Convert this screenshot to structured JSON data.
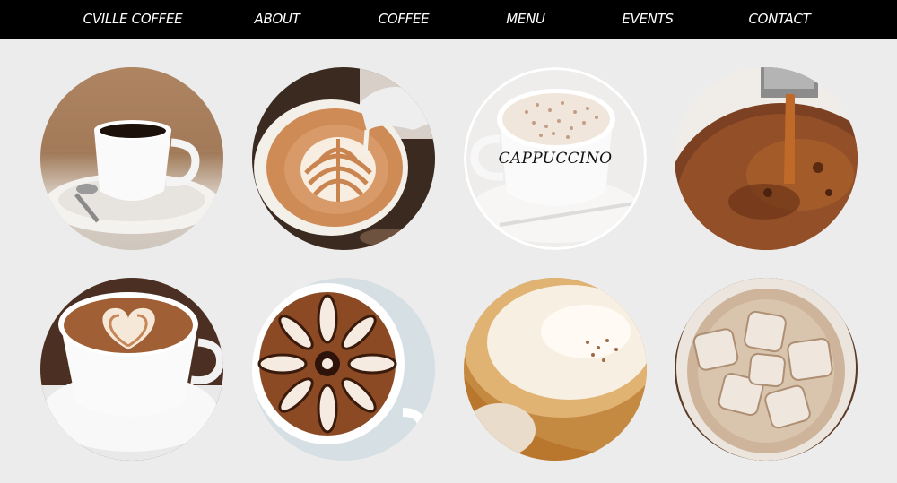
{
  "nav": {
    "items": [
      "CVILLE COFFEE",
      "ABOUT",
      "COFFEE",
      "MENU",
      "EVENTS",
      "CONTACT"
    ]
  },
  "gallery": {
    "tiles": [
      {
        "subject": "black coffee cup on saucer with spoon",
        "label": ""
      },
      {
        "subject": "latte art being poured from milk pitcher",
        "label": ""
      },
      {
        "subject": "cappuccino cup with chocolate sprinkles",
        "label": "CAPPUCCINO"
      },
      {
        "subject": "espresso shot pouring into cup",
        "label": ""
      },
      {
        "subject": "heart latte art in white cup",
        "label": ""
      },
      {
        "subject": "chocolate swirl flower latte",
        "label": ""
      },
      {
        "subject": "creamy coffee in beige cup",
        "label": ""
      },
      {
        "subject": "iced coffee with ice cubes in glass",
        "label": ""
      }
    ]
  },
  "colors": {
    "nav_bg": "#000000",
    "nav_text": "#ffffff",
    "page_bg": "#ececec"
  }
}
